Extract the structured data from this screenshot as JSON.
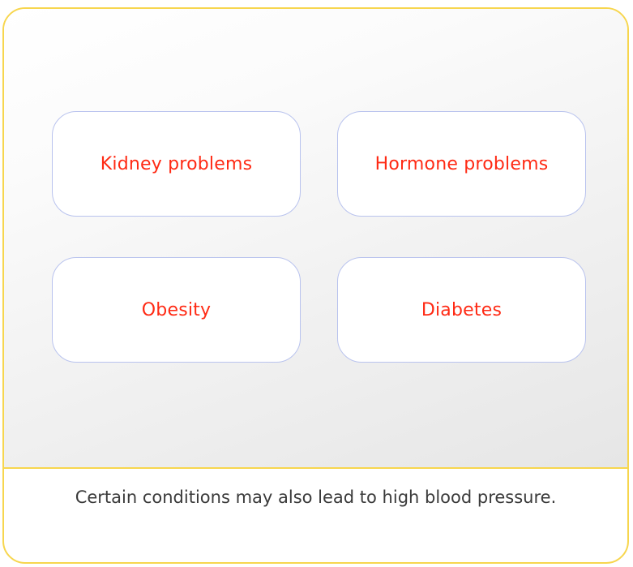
{
  "cards": [
    {
      "label": "Kidney problems"
    },
    {
      "label": "Hormone problems"
    },
    {
      "label": "Obesity"
    },
    {
      "label": "Diabetes"
    }
  ],
  "caption": "Certain conditions may also lead to high blood pressure.",
  "colors": {
    "border_accent": "#f7d64e",
    "card_border": "#b9c3ee",
    "card_text": "#ff2a14",
    "caption_text": "#3a3a3a"
  }
}
